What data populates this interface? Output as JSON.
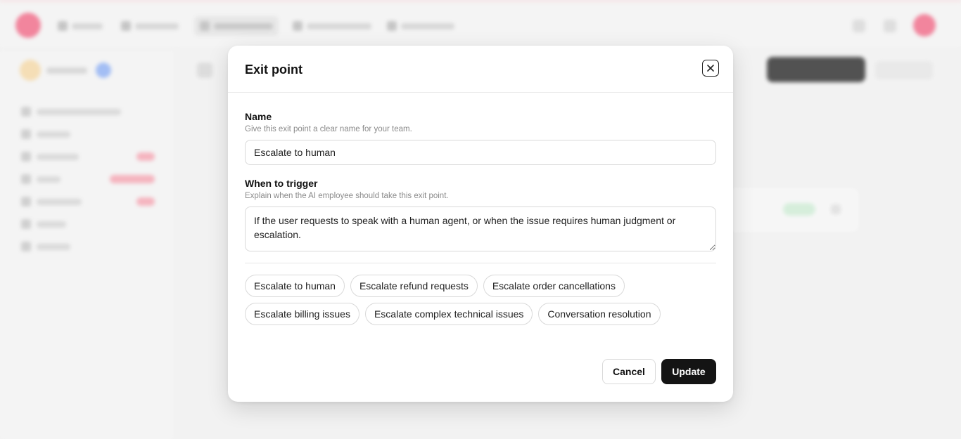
{
  "modal": {
    "title": "Exit point",
    "close_icon": "close-icon",
    "name_field": {
      "label": "Name",
      "help": "Give this exit point a clear name for your team.",
      "value": "Escalate to human"
    },
    "trigger_field": {
      "label": "When to trigger",
      "help": "Explain when the AI employee should take this exit point.",
      "value": "If the user requests to speak with a human agent, or when the issue requires human judgment or escalation."
    },
    "suggestions": [
      "Escalate to human",
      "Escalate refund requests",
      "Escalate order cancellations",
      "Escalate billing issues",
      "Escalate complex technical issues",
      "Conversation resolution"
    ],
    "cancel_label": "Cancel",
    "update_label": "Update"
  },
  "colors": {
    "primary_button": "#141414",
    "brand_accent": "#ef6b88",
    "page_background": "#f0f0f0"
  }
}
